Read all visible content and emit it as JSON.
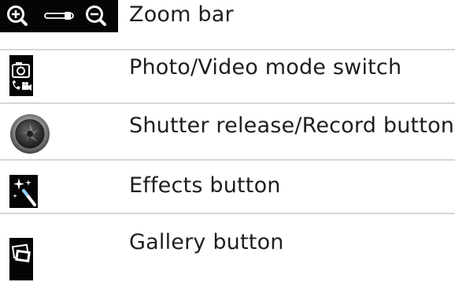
{
  "legend": {
    "items": [
      {
        "icon": "zoom-bar-icon",
        "label": "Zoom bar"
      },
      {
        "icon": "camera-video-switch-icon",
        "label": "Photo/Video mode switch"
      },
      {
        "icon": "shutter-icon",
        "label": "Shutter release/Record button"
      },
      {
        "icon": "magic-wand-icon",
        "label": "Effects button"
      },
      {
        "icon": "gallery-icon",
        "label": "Gallery button"
      }
    ]
  },
  "colors": {
    "divider": "#d6d6d6",
    "icon_bg": "#050505",
    "text": "#1e1e1e"
  }
}
